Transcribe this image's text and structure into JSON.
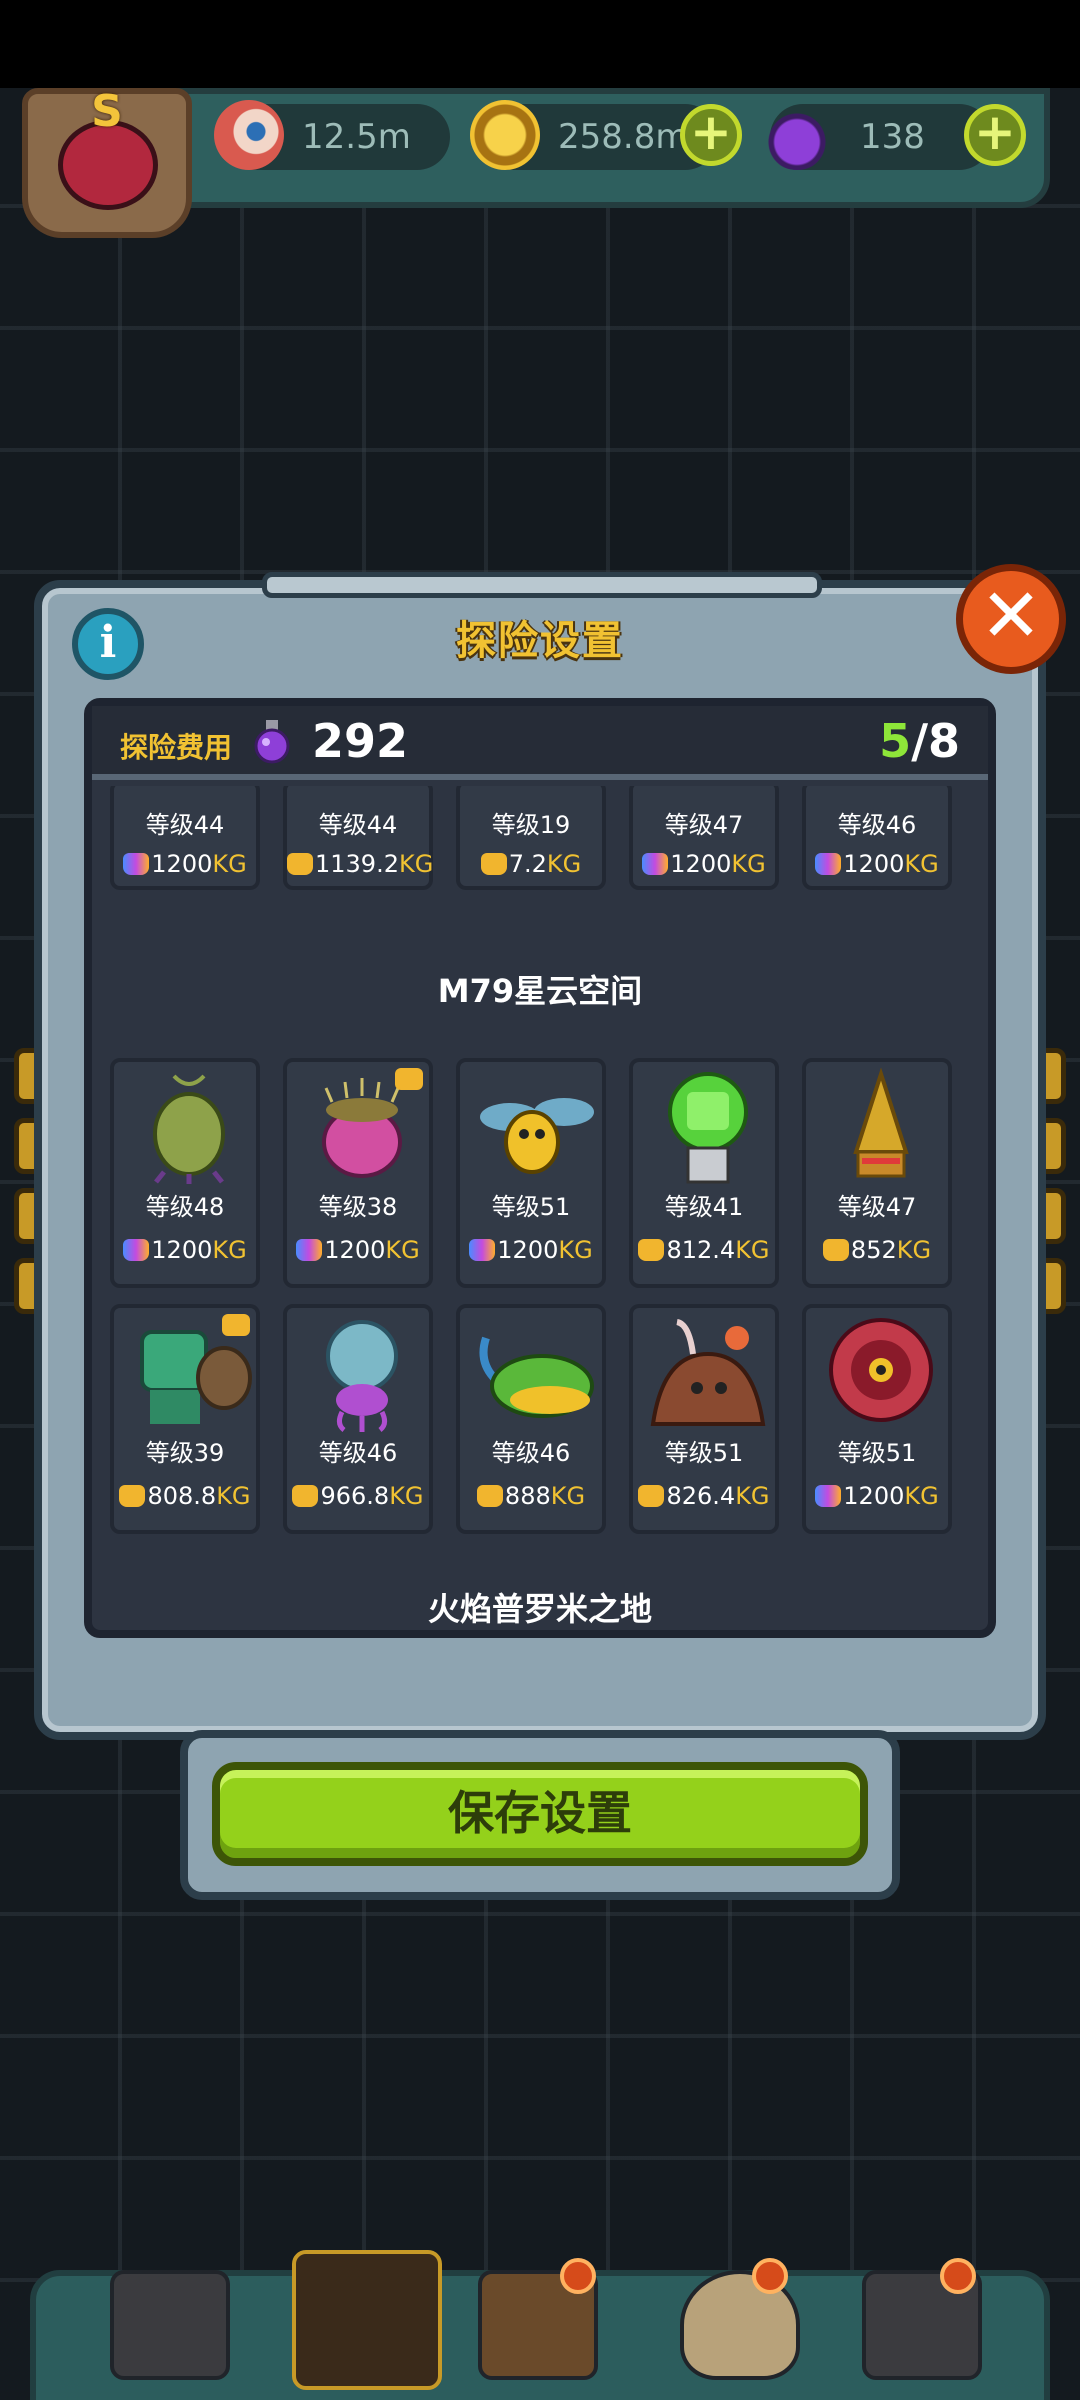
{
  "resources": {
    "eyes": "12.5m",
    "coins": "258.8m",
    "potions": "138",
    "avatar_letter": "S"
  },
  "modal": {
    "title": "探险设置",
    "info_icon": "i",
    "close_icon": "✕",
    "cost_label": "探险费用",
    "cost_value": "292",
    "slots_current": "5",
    "slots_total": "/8",
    "save_label": "保存设置"
  },
  "sections": [
    {
      "title": "",
      "cards": [
        {
          "level": "等级44",
          "weight": "1200",
          "unit": "KG",
          "bag": "rainbow"
        },
        {
          "level": "等级44",
          "weight": "1139.2",
          "unit": "KG",
          "bag": "gold"
        },
        {
          "level": "等级19",
          "weight": "7.2",
          "unit": "KG",
          "bag": "gold"
        },
        {
          "level": "等级47",
          "weight": "1200",
          "unit": "KG",
          "bag": "rainbow"
        },
        {
          "level": "等级46",
          "weight": "1200",
          "unit": "KG",
          "bag": "rainbow"
        }
      ]
    },
    {
      "title": "M79星云空间",
      "cards": [
        {
          "level": "等级48",
          "weight": "1200",
          "unit": "KG",
          "bag": "rainbow"
        },
        {
          "level": "等级38",
          "weight": "1200",
          "unit": "KG",
          "bag": "rainbow"
        },
        {
          "level": "等级51",
          "weight": "1200",
          "unit": "KG",
          "bag": "rainbow"
        },
        {
          "level": "等级41",
          "weight": "812.4",
          "unit": "KG",
          "bag": "gold"
        },
        {
          "level": "等级47",
          "weight": "852",
          "unit": "KG",
          "bag": "gold"
        },
        {
          "level": "等级39",
          "weight": "808.8",
          "unit": "KG",
          "bag": "gold"
        },
        {
          "level": "等级46",
          "weight": "966.8",
          "unit": "KG",
          "bag": "gold"
        },
        {
          "level": "等级46",
          "weight": "888",
          "unit": "KG",
          "bag": "gold"
        },
        {
          "level": "等级51",
          "weight": "826.4",
          "unit": "KG",
          "bag": "gold"
        },
        {
          "level": "等级51",
          "weight": "1200",
          "unit": "KG",
          "bag": "rainbow"
        }
      ]
    },
    {
      "title": "火焰普罗米之地",
      "cards": []
    }
  ],
  "colors": {
    "accent_yellow": "#f1c232",
    "slot_green": "#8ee639",
    "save_green": "#94d11b",
    "panel_dark": "#2d3441",
    "frame_steel": "#8ea4b1"
  }
}
